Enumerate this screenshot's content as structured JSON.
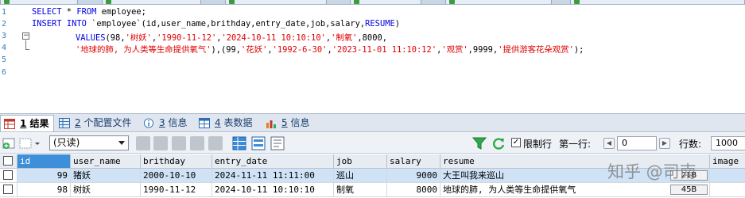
{
  "editor": {
    "line_numbers": [
      "1",
      "2",
      "3",
      "4",
      "5",
      "6"
    ],
    "fold_marker": "−",
    "line1": {
      "kw1": "SELECT",
      "rest1": " * ",
      "kw2": "FROM",
      "rest2": " employee;"
    },
    "line2": {
      "kw1": "INSERT",
      "rest1": " ",
      "kw2": "INTO",
      "rest2": " `employee`(id,user_name,brithday,entry_date,job,salary,",
      "kw3": "RESUME",
      "rest3": ")"
    },
    "line3": {
      "kw1": "VALUES",
      "rest1": "(98,",
      "s1": "'树妖'",
      "c1": ",",
      "s2": "'1990-11-12'",
      "c2": ",",
      "s3": "'2024-10-11 10:10:10'",
      "c3": ",",
      "s4": "'制氧'",
      "c4": ",8000,"
    },
    "line4": {
      "s1": "'地球的肺, 为人类等生命提供氧气'",
      "m1": "),(99,",
      "s2": "'花妖'",
      "c1": ",",
      "s3": "'1992-6-30'",
      "c2": ",",
      "s4": "'2023-11-01 11:10:12'",
      "c3": ",",
      "s5": "'观赏'",
      "c4": ",9999,",
      "s6": "'提供游客花朵观赏'",
      "end": ");"
    }
  },
  "result_tabs": [
    {
      "num": "1",
      "label": " 结果"
    },
    {
      "num": "2",
      "label": " 个配置文件"
    },
    {
      "num": "3",
      "label": " 信息"
    },
    {
      "num": "4",
      "label": " 表数据"
    },
    {
      "num": "5",
      "label": " 信息"
    }
  ],
  "toolbar": {
    "mode_select": "(只读)",
    "limit_rows_label": "限制行",
    "first_row_label": "第一行:",
    "first_row_value": "0",
    "rows_label": "行数:",
    "rows_value": "1000"
  },
  "grid": {
    "columns": [
      "id",
      "user_name",
      "brithday",
      "entry_date",
      "job",
      "salary",
      "resume",
      "image"
    ],
    "rows": [
      {
        "id": "99",
        "user_name": "猪妖",
        "brithday": "2000-10-10",
        "entry_date": "2024-11-11 11:11:00",
        "job": "巡山",
        "salary": "9000",
        "resume": "大王叫我来巡山",
        "blob": "21B"
      },
      {
        "id": "98",
        "user_name": "树妖",
        "brithday": "1990-11-12",
        "entry_date": "2024-10-11 10:10:10",
        "job": "制氧",
        "salary": "8000",
        "resume": "地球的肺, 为人类等生命提供氧气",
        "blob": "45B"
      }
    ]
  },
  "watermark": "知乎 @司南",
  "colors": {
    "keyword": "#0000e6",
    "string": "#e00000",
    "line_number": "#2e7fb8",
    "selected_row": "#cfe2f6",
    "selected_header": "#3c8fd8"
  }
}
